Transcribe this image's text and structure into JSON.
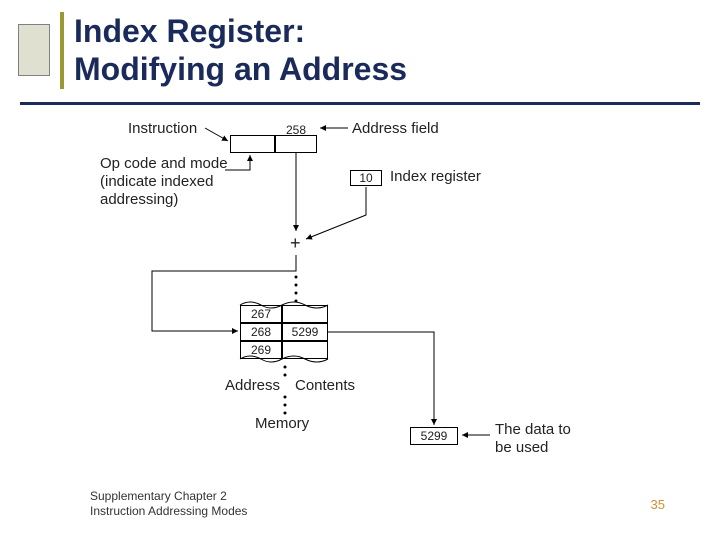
{
  "title_line1": "Index Register:",
  "title_line2": "Modifying an Address",
  "footer_line1": "Supplementary Chapter 2",
  "footer_line2": "Instruction Addressing Modes",
  "page_number": "35",
  "labels": {
    "instruction": "Instruction",
    "address_field": "Address field",
    "opcode": "Op code and mode",
    "opcode2": "(indicate indexed",
    "opcode3": "addressing)",
    "index_register": "Index register",
    "address": "Address",
    "contents": "Contents",
    "memory": "Memory",
    "data1": "The data to",
    "data2": "be used",
    "plus": "+"
  },
  "values": {
    "instr_addr": "258",
    "index_val": "10",
    "addr1": "267",
    "addr2": "268",
    "addr3": "269",
    "cont2": "5299",
    "result": "5299"
  }
}
